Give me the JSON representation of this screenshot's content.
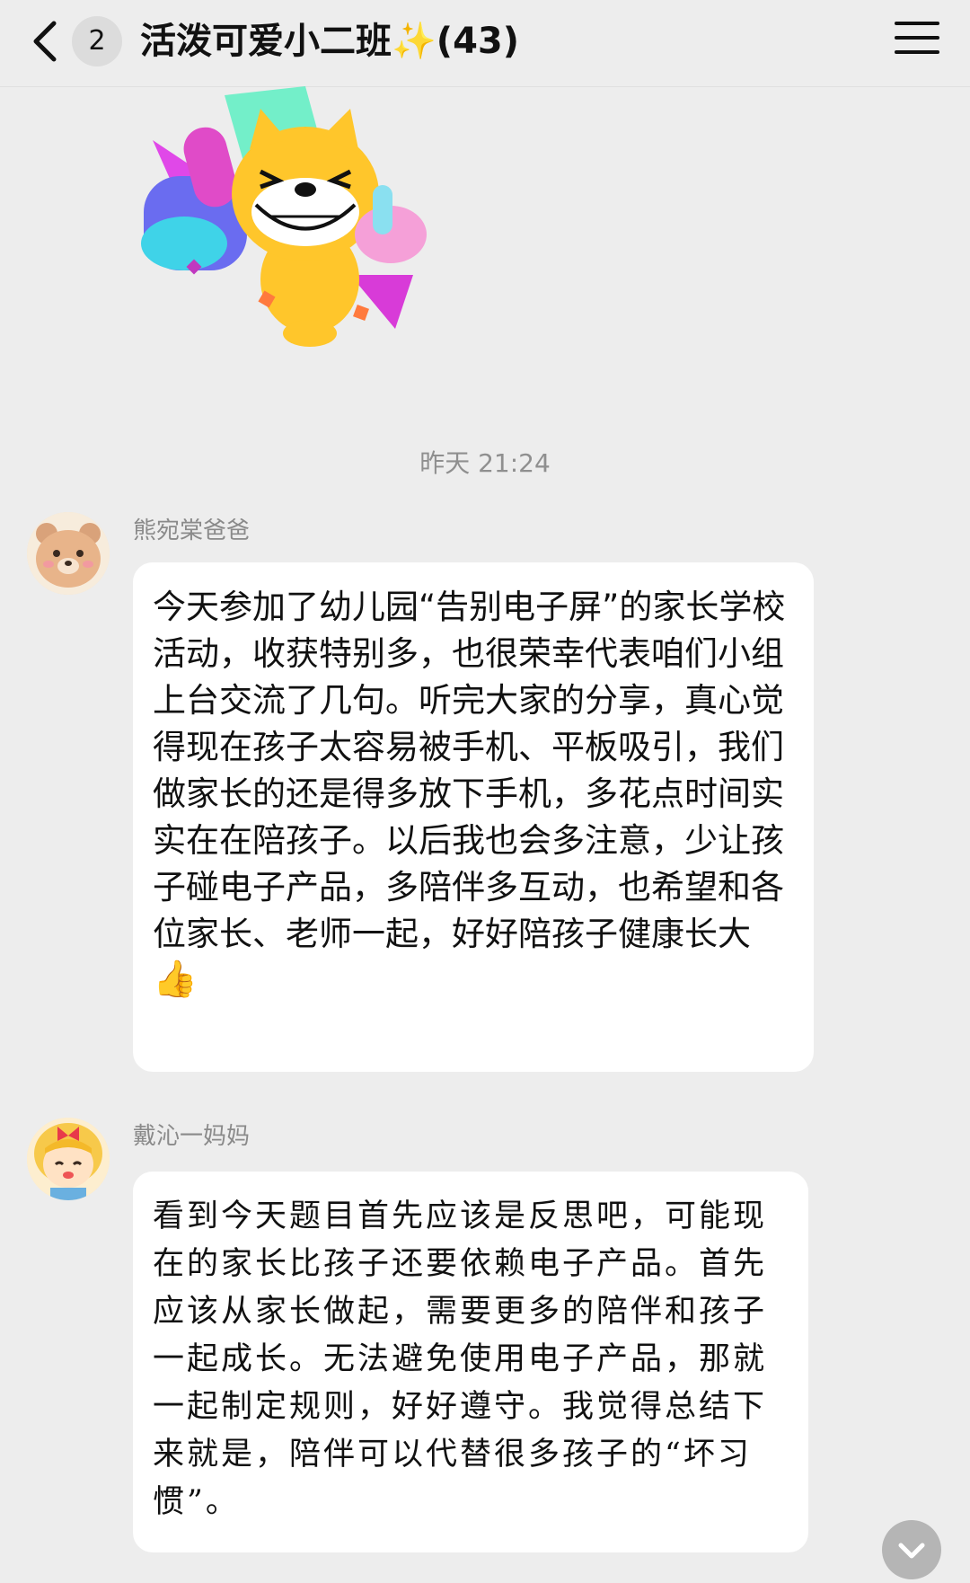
{
  "header": {
    "back_icon": "chevron-left-icon",
    "unread_count": "2",
    "title": "活泼可爱小二班✨(43)",
    "menu_icon": "menu-icon"
  },
  "sticker": {
    "description_icon": "thumbs-up-cat-sticker"
  },
  "timestamp": "昨天 21:24",
  "messages": [
    {
      "sender": "熊宛棠爸爸",
      "avatar_icon": "bear-avatar",
      "text": "今天参加了幼儿园“告别电子屏”的家长学校活动，收获特别多，也很荣幸代表咱们小组上台交流了几句。听完大家的分享，真心觉得现在孩子太容易被手机、平板吸引，我们做家长的还是得多放下手机，多花点时间实实在在陪孩子。以后我也会多注意，少让孩子碰电子产品，多陪伴多互动，也希望和各位家长、老师一起，好好陪孩子健康长大",
      "emoji": "👍"
    },
    {
      "sender": "戴沁一妈妈",
      "avatar_icon": "girl-avatar",
      "text": "看到今天题目首先应该是反思吧，可能现在的家长比孩子还要依赖电子产品。首先应该从家长做起，需要更多的陪伴和孩子一起成长。无法避免使用电子产品，那就一起制定规则，好好遵守。我觉得总结下来就是，陪伴可以代替很多孩子的“坏习惯”。"
    }
  ],
  "scroll_button_icon": "chevron-down-icon"
}
